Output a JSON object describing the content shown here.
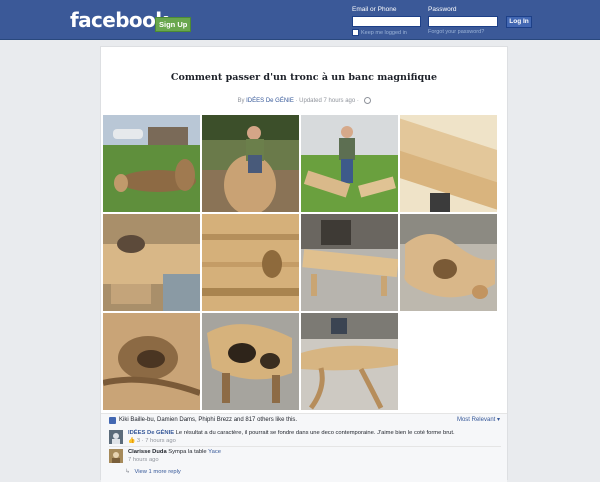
{
  "header": {
    "logo": "facebook",
    "signup_label": "Sign Up",
    "email_label": "Email or Phone",
    "password_label": "Password",
    "login_label": "Log In",
    "keep_logged_in": "Keep me logged in",
    "forgot_password": "Forgot your password?"
  },
  "post": {
    "title": "Comment passer d'un tronc à un banc magnifique",
    "by": "By",
    "page_name": "IDÉES De GÉNIE",
    "updated": "· Updated 7 hours ago ·"
  },
  "reactions": {
    "likes_text": "Kiki Baille-bu, Damien Dams, Phiphi Brezz and 817 others like this.",
    "most_relevant": "Most Relevant ▾"
  },
  "comments": [
    {
      "author": "IDÉES De GÉNIE",
      "text": "Le résultat a du caractère, il pourrait se fondre dans une deco contemporaine. J'aime bien le coté forme brut.",
      "meta": "3 · 7 hours ago"
    },
    {
      "author": "Clarisse Duda",
      "text": "Sympa la table",
      "mention": "Yace",
      "meta": "7 hours ago"
    }
  ],
  "view_more": "View 1 more reply"
}
